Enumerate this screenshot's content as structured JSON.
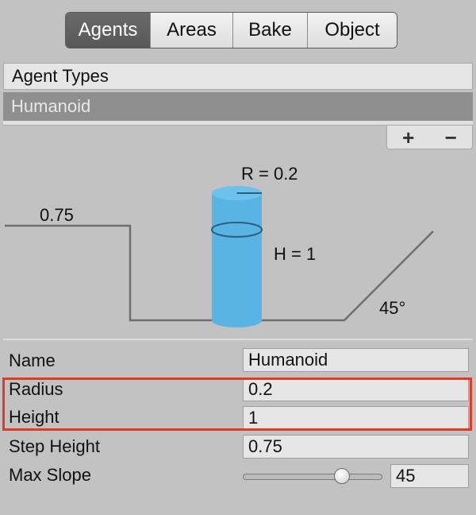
{
  "tabs": [
    {
      "label": "Agents",
      "active": true
    },
    {
      "label": "Areas",
      "active": false
    },
    {
      "label": "Bake",
      "active": false
    },
    {
      "label": "Object",
      "active": false
    }
  ],
  "agent_types": {
    "header": "Agent Types",
    "items": [
      "Humanoid"
    ],
    "add_label": "+",
    "remove_label": "−"
  },
  "diagram": {
    "radius_label": "R = 0.2",
    "height_label": "H = 1",
    "step_label": "0.75",
    "slope_label": "45°",
    "agent_color": "#58b4e3"
  },
  "form": {
    "name_label": "Name",
    "name_value": "Humanoid",
    "radius_label": "Radius",
    "radius_value": "0.2",
    "height_label": "Height",
    "height_value": "1",
    "step_label": "Step Height",
    "step_value": "0.75",
    "slope_label": "Max Slope",
    "slope_value": "45",
    "slope_fraction": 0.711
  },
  "highlight_color": "#e23a24"
}
